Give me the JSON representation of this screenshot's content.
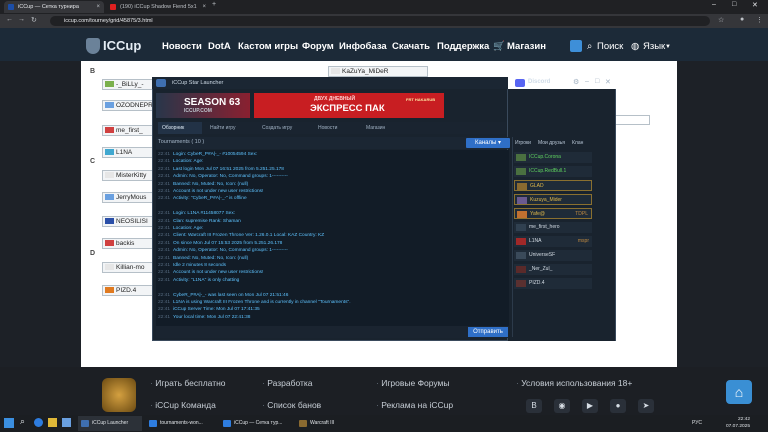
{
  "browser": {
    "tabs": [
      {
        "title": "iCCup — Сетка турнира"
      },
      {
        "title": "(190) iCCup Shadow Fiend 5x1"
      }
    ],
    "url": "iccup.com/tourney/grid/45875/3.html"
  },
  "site": {
    "logo": "ICCup",
    "nav": [
      "Новости",
      "DotA",
      "Кастом игры",
      "Форум",
      "Инфобаза",
      "Скачать",
      "Поддержка",
      "Магазин"
    ],
    "search": "Поиск",
    "lang": "Язык"
  },
  "bracket": {
    "groups": [
      "B",
      "C",
      "D"
    ],
    "left_slots": [
      "-_BiLLy_-",
      "OZODNEPR",
      "me_first_",
      "L1NA",
      "MisterKitty",
      "JerryMous",
      "NEOSILISI",
      "backis",
      "Killian-mo",
      "PIZD.4"
    ],
    "right_slots": [
      "KaZuYa_MiDeR"
    ]
  },
  "launcher": {
    "title": "iCCup Star Launcher",
    "discord": "Discord",
    "banner_left": "SEASON 63",
    "banner_left_sub": "ICCUP.COM",
    "banner_right": "ЭКСПРЕСС ПАК",
    "banner_right_sub": "ДВУХ ДНЕВНЫЙ",
    "banner_right_tag": "FRT HAKARUB",
    "tabs": [
      "Обзорник",
      "Найти игру",
      "Создать игру",
      "Новости",
      "Магазин"
    ],
    "channel_label": "Tournaments ( 10 )",
    "channels_button": "Каналы",
    "send_button": "Отправить",
    "chat": [
      {
        "t": "22:41",
        "text": "Login: CybeR_P#A|-_-  #10054594 Sex:"
      },
      {
        "t": "22:41",
        "text": "Location:                         Age:"
      },
      {
        "t": "22:41",
        "text": "Last login Mon Jul 07 16:51 2025 from 5.251.25.178"
      },
      {
        "t": "22:41",
        "text": "Admin: No, Operator: No, Command groups: 1----------"
      },
      {
        "t": "22:41",
        "text": "Banned: No, Muted: No, Icon: (null)"
      },
      {
        "t": "22:41",
        "text": "Account is not under new user restrictions!"
      },
      {
        "t": "22:41",
        "text": "Activity: \"CybeR_P#A|-_-\" is offline"
      },
      {
        "t": "22:41",
        "text": ""
      },
      {
        "t": "22:41",
        "text": "Login: L1NA                 #11458077 Sex:"
      },
      {
        "t": "22:41",
        "text": "Clan: supremise                          Rank: Shaman"
      },
      {
        "t": "22:41",
        "text": "Location:                         Age:"
      },
      {
        "t": "22:41",
        "text": "Client: Warcraft III Frozen Throne   Ver: 1.26.0.1   Local: KAZ  Country: KZ"
      },
      {
        "t": "22:41",
        "text": "On since Mon Jul 07 15:53 2025 from 5.251.26.178"
      },
      {
        "t": "22:41",
        "text": "Admin: No, Operator: No, Command groups: 1----------"
      },
      {
        "t": "22:41",
        "text": "Banned: No, Muted: No, Icon: (null)"
      },
      {
        "t": "22:41",
        "text": "Idle 2 minutes 8 seconds"
      },
      {
        "t": "22:41",
        "text": "Account is not under new user restrictions!"
      },
      {
        "t": "22:41",
        "text": "Activity: \"L1NA\" is only chatting"
      },
      {
        "t": "22:41",
        "text": ""
      },
      {
        "t": "22:41",
        "text": "CybeR_P#A|-_- was last seen on Mon Jul 07 21:51:46"
      },
      {
        "t": "22:41",
        "text": "L1NA is using Warcraft III Frozen Throne and is currently in channel \"Tournaments\"."
      },
      {
        "t": "22:41",
        "text": "iCCup Server Time: Mon Jul 07 17:41:35"
      },
      {
        "t": "22:41",
        "text": "Your local time: Mon Jul 07 22:41:38"
      }
    ],
    "right_tabs": [
      "Игроки",
      "Мои друзья",
      "Клан"
    ],
    "users": [
      {
        "name": "ICCup.Corona",
        "color": "#5fd35f",
        "extra": ""
      },
      {
        "name": "ICCup.RedBull.1",
        "color": "#5fd35f",
        "extra": ""
      },
      {
        "name": "GLAD",
        "color": "#e0b84a",
        "extra": ""
      },
      {
        "name": "Kuzuya_Mider",
        "color": "#e0b84a",
        "extra": ""
      },
      {
        "name": "Yafe@",
        "color": "#e0b84a",
        "extra": "TDPL"
      },
      {
        "name": "me_first_hero",
        "color": "#d5dde6",
        "extra": ""
      },
      {
        "name": "L1NA",
        "color": "#d5dde6",
        "extra": "mspr"
      },
      {
        "name": "UniverseSF",
        "color": "#d5dde6",
        "extra": ""
      },
      {
        "name": "_Ner_Zul_",
        "color": "#d5dde6",
        "extra": ""
      },
      {
        "name": "PIZD.4",
        "color": "#d5dde6",
        "extra": ""
      }
    ]
  },
  "footer": {
    "links": [
      "Играть бесплатно",
      "Разработка",
      "Игровые Форумы",
      "Условия использования 18+",
      "iCCup Команда",
      "Список банов",
      "Реклама на iCCup"
    ]
  },
  "taskbar": {
    "items": [
      "iCCup Launcher",
      "tournaments-won...",
      "iCCup — Сетка тур...",
      "Warcraft III"
    ],
    "time": "22:42",
    "date": "07.07.2025",
    "lang": "РУС"
  }
}
